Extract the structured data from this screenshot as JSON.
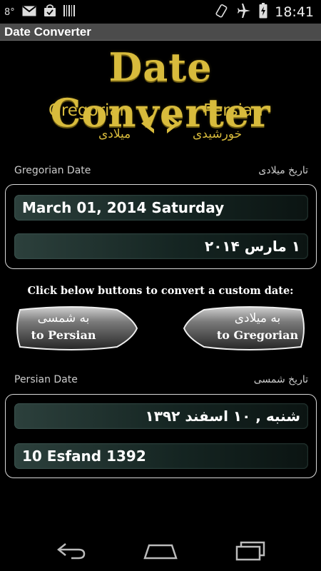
{
  "status_bar": {
    "temperature": "8°",
    "time": "18:41",
    "left_icons": [
      "gmail-icon",
      "shopping-bag-icon",
      "barcode-icon"
    ],
    "right_icons": [
      "phone-rotate-icon",
      "airplane-icon",
      "battery-charging-icon"
    ]
  },
  "app": {
    "title": "Date Converter"
  },
  "banner": {
    "title": "Date Converter",
    "gregorian": "Gregorian",
    "persian": "Persian",
    "gregorian_fa": "میلادی",
    "persian_fa": "خورشیدی"
  },
  "gregorian_section": {
    "label_en": "Gregorian Date",
    "label_fa": "تاریخ میلادی",
    "date_en": "March 01, 2014 Saturday",
    "date_fa": "۱ مارس ۲۰۱۴"
  },
  "instruction": "Click below buttons to convert a custom date:",
  "buttons": {
    "to_persian": {
      "fa": "به شمسی",
      "en": "to Persian"
    },
    "to_gregorian": {
      "fa": "به میلادی",
      "en": "to Gregorian"
    }
  },
  "persian_section": {
    "label_en": "Persian Date",
    "label_fa": "تاریخ شمسی",
    "date_fa": "شنبه , ۱۰ اسفند ۱۳۹۲",
    "date_en": "10 Esfand 1392"
  },
  "colors": {
    "gold": "#d8bb3c",
    "title_bar": "#4b4b4b",
    "field_dark_teal": "#152522",
    "panel_border": "#d9d9d9"
  },
  "nav": [
    "back-icon",
    "home-icon",
    "recent-apps-icon"
  ]
}
